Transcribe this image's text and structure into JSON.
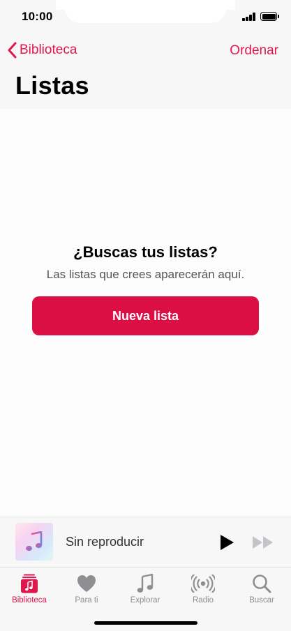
{
  "status_bar": {
    "time": "10:00"
  },
  "nav": {
    "back_label": "Biblioteca",
    "sort_label": "Ordenar"
  },
  "page": {
    "title": "Listas"
  },
  "empty_state": {
    "title": "¿Buscas tus listas?",
    "subtitle": "Las listas que crees aparecerán aquí.",
    "button_label": "Nueva lista"
  },
  "mini_player": {
    "title": "Sin reproducir",
    "artwork_icon": "music-note-icon"
  },
  "tabs": [
    {
      "label": "Biblioteca",
      "icon": "library-icon",
      "active": true
    },
    {
      "label": "Para ti",
      "icon": "heart-icon",
      "active": false
    },
    {
      "label": "Explorar",
      "icon": "music-note-icon",
      "active": false
    },
    {
      "label": "Radio",
      "icon": "radio-icon",
      "active": false
    },
    {
      "label": "Buscar",
      "icon": "search-icon",
      "active": false
    }
  ],
  "colors": {
    "accent": "#e0174c",
    "button": "#dc0f45",
    "inactive": "#8e8e93"
  }
}
